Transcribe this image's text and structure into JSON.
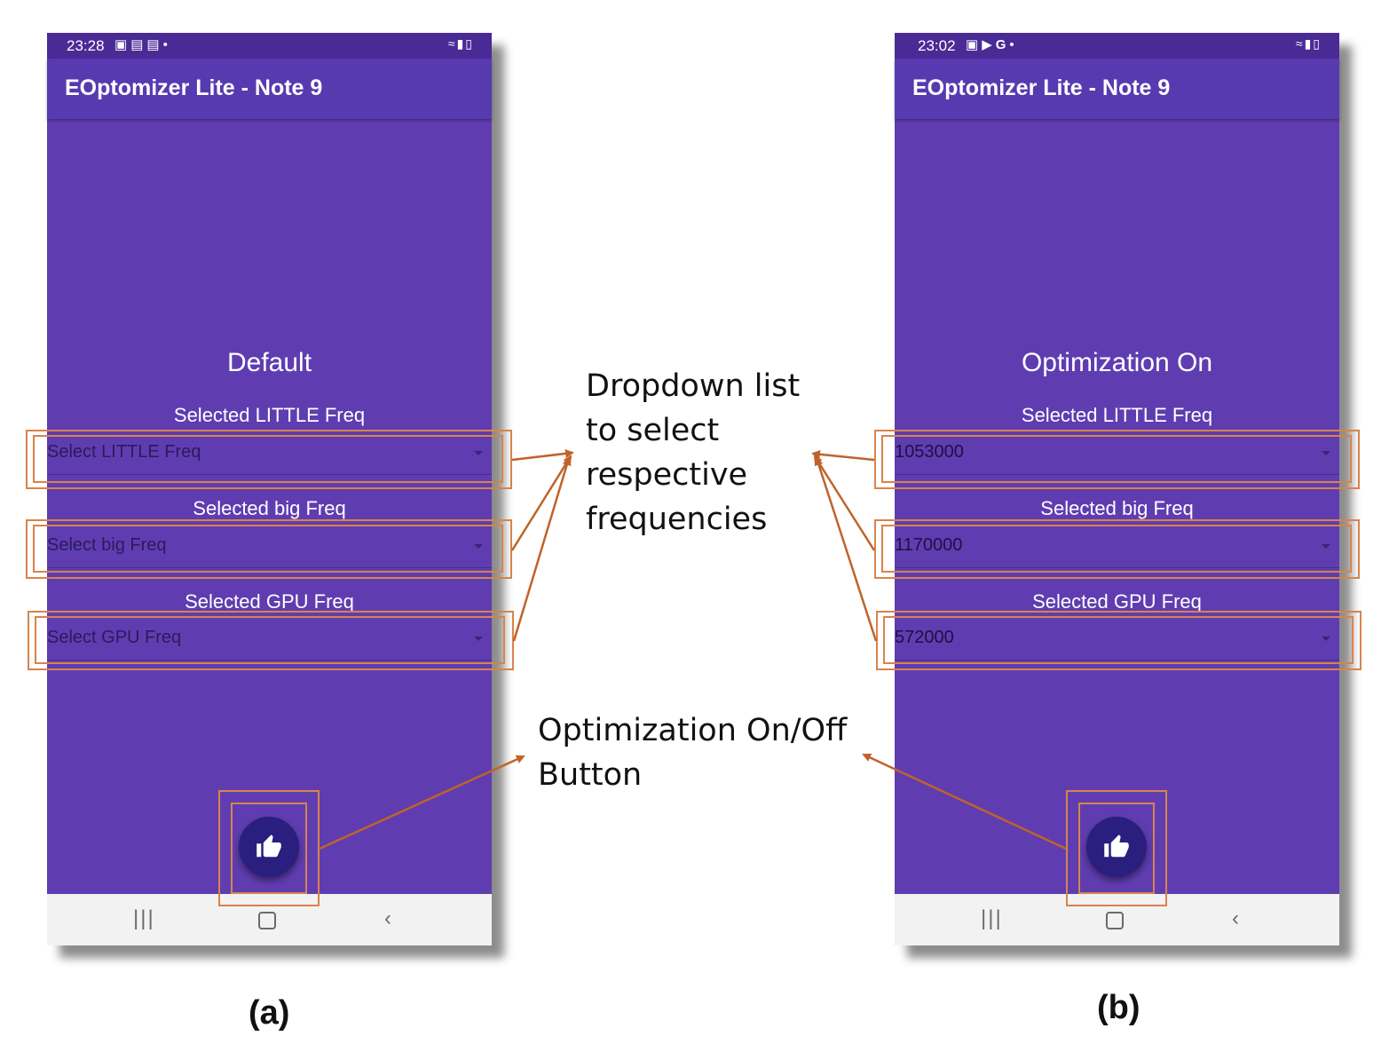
{
  "colors": {
    "app_background": "#5f3db1",
    "status_bar": "#4a2b96",
    "app_bar": "#573ab0",
    "fab": "#2a1f7e",
    "highlight": "#d9834a",
    "arrow": "#c0632a"
  },
  "phones": [
    {
      "status_bar": {
        "time": "23:28",
        "icons": [
          "notification-icon",
          "gallery-icon",
          "calendar-icon",
          "dot-icon",
          "wifi-icon",
          "signal-icon",
          "battery-icon"
        ]
      },
      "app_title": "EOptomizer Lite - Note 9",
      "status_label": "Default",
      "little_label": "Selected LITTLE Freq",
      "little_value": "Select LITTLE Freq",
      "big_label": "Selected big Freq",
      "big_value": "Select big Freq",
      "gpu_label": "Selected GPU Freq",
      "gpu_value": "Select GPU Freq",
      "fab_icon": "thumbs-up-icon",
      "nav_icons": [
        "recent-apps-icon",
        "home-icon",
        "back-icon"
      ]
    },
    {
      "status_bar": {
        "time": "23:02",
        "icons": [
          "notification-icon",
          "youtube-icon",
          "google-icon",
          "dot-icon",
          "wifi-icon",
          "signal-icon",
          "battery-icon"
        ]
      },
      "app_title": "EOptomizer Lite - Note 9",
      "status_label": "Optimization On",
      "little_label": "Selected LITTLE Freq",
      "little_value": "1053000",
      "big_label": "Selected big Freq",
      "big_value": "1170000",
      "gpu_label": "Selected GPU Freq",
      "gpu_value": "572000",
      "fab_icon": "thumbs-up-icon",
      "nav_icons": [
        "recent-apps-icon",
        "home-icon",
        "back-icon"
      ]
    }
  ],
  "annotations": {
    "dropdown_callout": [
      "Dropdown list",
      "to select",
      "respective",
      "frequencies"
    ],
    "button_callout": [
      "Optimization On/Off",
      "Button"
    ]
  },
  "captions": [
    "(a)",
    "(b)"
  ]
}
